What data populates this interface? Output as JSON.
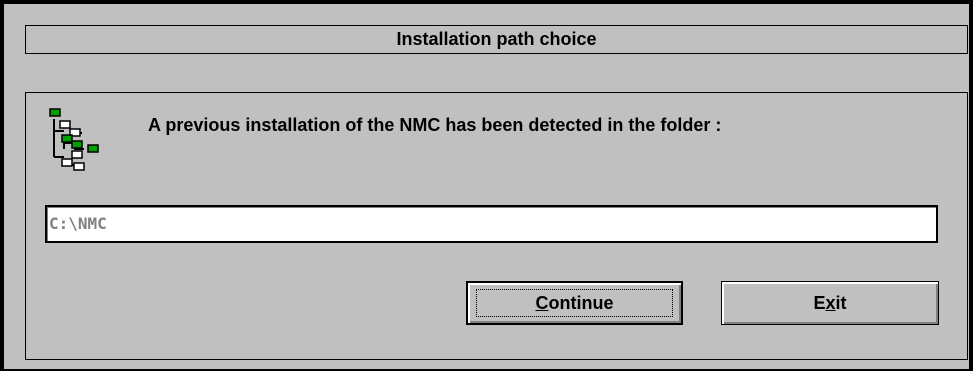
{
  "dialog": {
    "title": "Installation path choice",
    "message": "A previous installation of the NMC has been detected in the folder :",
    "path_value": "C:\\NMC",
    "icon": "folder-tree-icon"
  },
  "buttons": {
    "continue": {
      "mnemonic": "C",
      "rest": "ontinue"
    },
    "exit": {
      "pre": "E",
      "mnemonic": "x",
      "rest": "it"
    }
  },
  "colors": {
    "face": "#c0c0c0",
    "folder_green": "#00a000",
    "disabled_text": "#808080"
  }
}
